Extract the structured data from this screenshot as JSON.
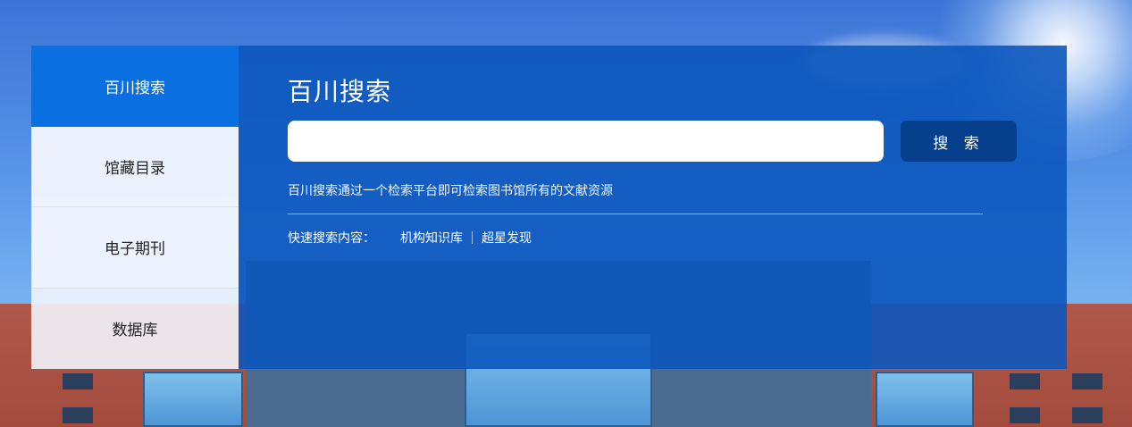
{
  "sidebar": {
    "items": [
      {
        "label": "百川搜索",
        "active": true
      },
      {
        "label": "馆藏目录",
        "active": false
      },
      {
        "label": "电子期刊",
        "active": false
      },
      {
        "label": "数据库",
        "active": false
      }
    ]
  },
  "search": {
    "title": "百川搜索",
    "input_value": "",
    "placeholder": "",
    "button_label": "搜 索",
    "description": "百川搜索通过一个检索平台即可检索图书馆所有的文献资源"
  },
  "quick_search": {
    "label": "快速搜索内容：",
    "links": [
      "机构知识库",
      "超星发现"
    ]
  },
  "colors": {
    "active_tab": "#0a6fe0",
    "panel_bg": "#0c56be",
    "button_bg": "#063f8c"
  }
}
